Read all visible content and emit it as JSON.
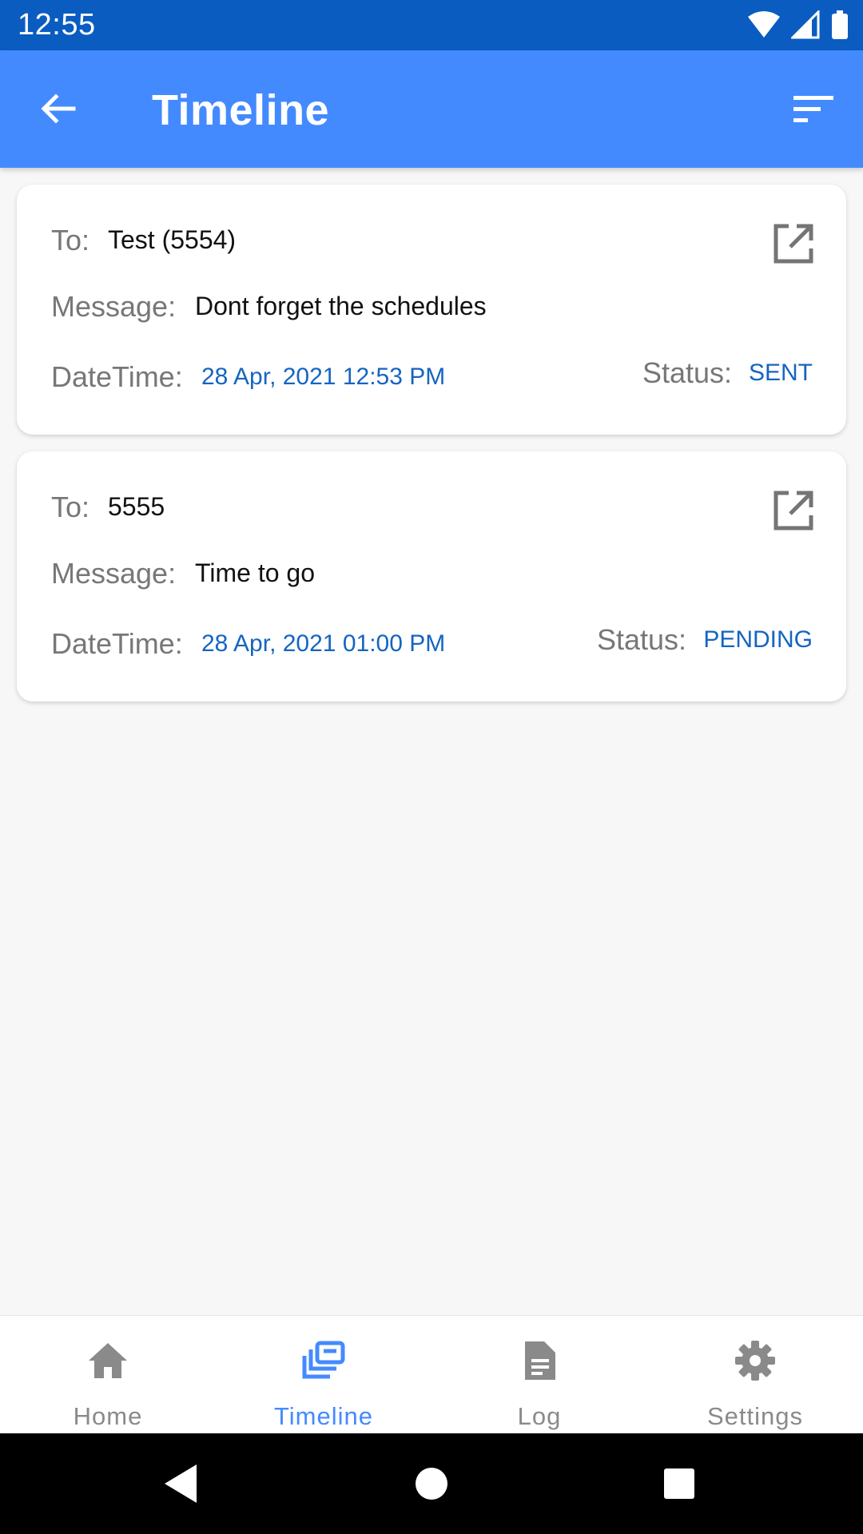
{
  "status_bar": {
    "time": "12:55"
  },
  "app_bar": {
    "title": "Timeline"
  },
  "labels": {
    "to": "To:",
    "message": "Message:",
    "datetime": "DateTime:",
    "status": "Status:"
  },
  "messages": [
    {
      "to": "Test (5554)",
      "message": "Dont forget the schedules",
      "datetime": "28 Apr, 2021 12:53 PM",
      "status": "SENT"
    },
    {
      "to": "5555",
      "message": "Time to go",
      "datetime": "28 Apr, 2021 01:00 PM",
      "status": "PENDING"
    }
  ],
  "bottom_nav": {
    "items": [
      {
        "label": "Home",
        "icon": "home-icon"
      },
      {
        "label": "Timeline",
        "icon": "timeline-icon",
        "active": true
      },
      {
        "label": "Log",
        "icon": "document-icon"
      },
      {
        "label": "Settings",
        "icon": "gear-icon"
      }
    ]
  },
  "colors": {
    "primary": "#448aff",
    "status_bar": "#0a5cc0",
    "accent_text": "#1565c0"
  }
}
